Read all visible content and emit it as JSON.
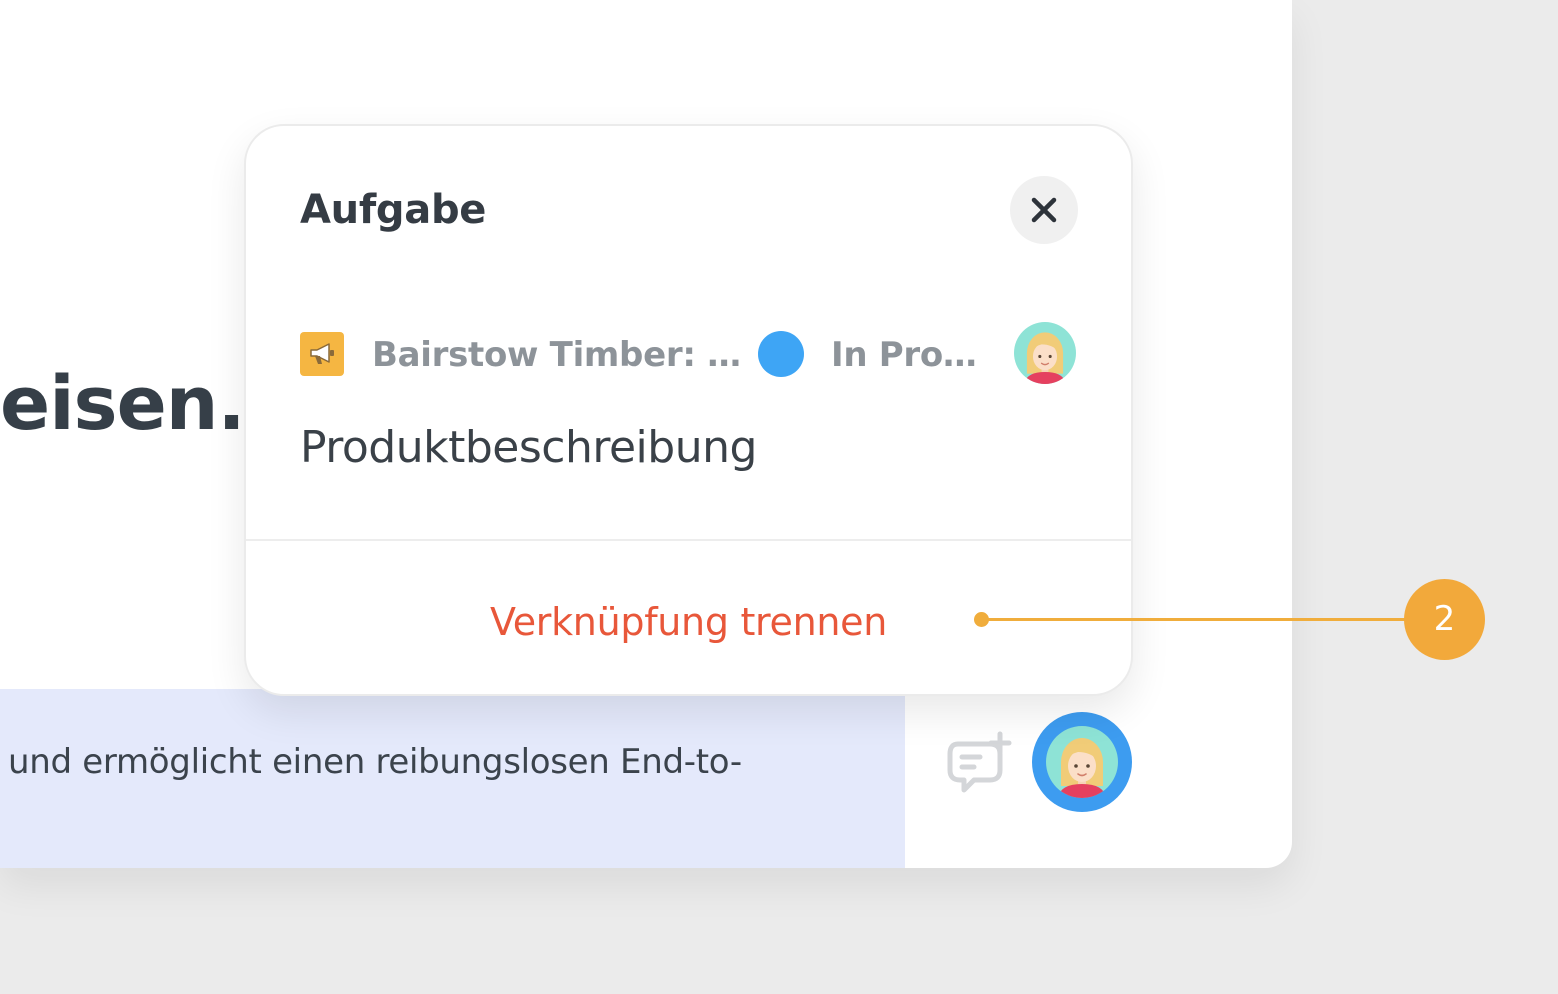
{
  "document": {
    "heading_fragment": "eisen.",
    "highlight_text": "und ermöglicht einen reibungslosen End-to-",
    "add_comment_icon": "comment-add-icon",
    "user_avatar_icon": "user-avatar"
  },
  "popup": {
    "title": "Aufgabe",
    "close_icon": "close-icon",
    "project_icon": "megaphone-icon",
    "project_name": "Bairstow Timber: …",
    "status_color": "#3ea5f5",
    "status_label": "In Pro…",
    "assignee_icon": "user-avatar",
    "task_name": "Produktbeschreibung",
    "unlink_label": "Verknüpfung trennen",
    "unlink_color": "#e8573a"
  },
  "callout": {
    "number": "2",
    "color": "#f2a93b"
  }
}
